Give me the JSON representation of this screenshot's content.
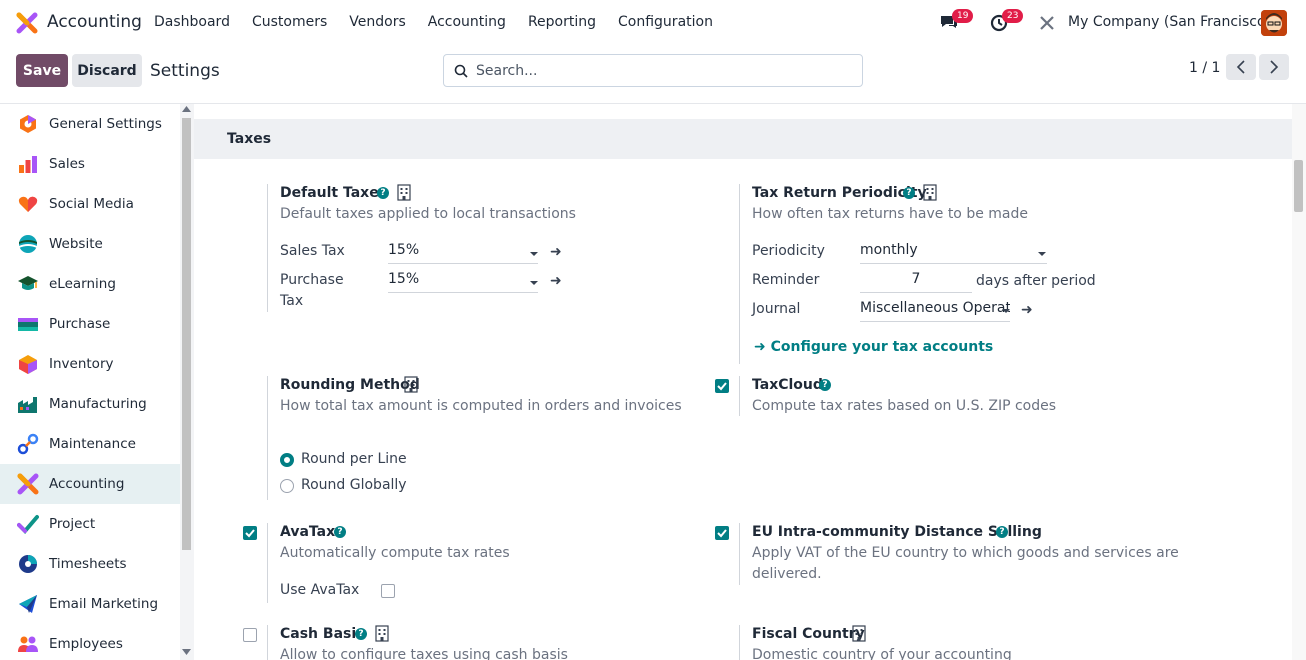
{
  "navbar": {
    "app_name": "Accounting",
    "menu": [
      "Dashboard",
      "Customers",
      "Vendors",
      "Accounting",
      "Reporting",
      "Configuration"
    ],
    "messages_count": "19",
    "activities_count": "23",
    "company": "My Company (San Francisco)"
  },
  "control_panel": {
    "save_label": "Save",
    "discard_label": "Discard",
    "title": "Settings",
    "search_placeholder": "Search...",
    "pager": "1 / 1"
  },
  "sidebar": {
    "items": [
      {
        "label": "General Settings",
        "icon": "general-settings-icon",
        "color": "#f97316"
      },
      {
        "label": "Sales",
        "icon": "sales-icon",
        "color": "#ef4444"
      },
      {
        "label": "Social Media",
        "icon": "social-media-icon",
        "color": "#f97316"
      },
      {
        "label": "Website",
        "icon": "website-icon",
        "color": "#0ea5b7"
      },
      {
        "label": "eLearning",
        "icon": "elearning-icon",
        "color": "#14532d"
      },
      {
        "label": "Purchase",
        "icon": "purchase-icon",
        "color": "#0f766e"
      },
      {
        "label": "Inventory",
        "icon": "inventory-icon",
        "color": "#f59e0b"
      },
      {
        "label": "Manufacturing",
        "icon": "manufacturing-icon",
        "color": "#0f766e"
      },
      {
        "label": "Maintenance",
        "icon": "maintenance-icon",
        "color": "#3b82f6"
      },
      {
        "label": "Accounting",
        "icon": "accounting-icon",
        "color": "#f97316",
        "active": true
      },
      {
        "label": "Project",
        "icon": "project-icon",
        "color": "#0d9488"
      },
      {
        "label": "Timesheets",
        "icon": "timesheets-icon",
        "color": "#1e3a8a"
      },
      {
        "label": "Email Marketing",
        "icon": "email-marketing-icon",
        "color": "#1d4ed8"
      },
      {
        "label": "Employees",
        "icon": "employees-icon",
        "color": "#a855f7"
      }
    ]
  },
  "section": {
    "title": "Taxes",
    "default_taxes": {
      "title": "Default Taxes",
      "desc": "Default taxes applied to local transactions",
      "sales_tax_label": "Sales Tax",
      "sales_tax_value": "15%",
      "purchase_tax_label_1": "Purchase",
      "purchase_tax_label_2": "Tax",
      "purchase_tax_value": "15%"
    },
    "tax_return": {
      "title": "Tax Return Periodicity",
      "desc": "How often tax returns have to be made",
      "periodicity_label": "Periodicity",
      "periodicity_value": "monthly",
      "reminder_label": "Reminder",
      "reminder_value": "7",
      "reminder_suffix": "days after period",
      "journal_label": "Journal",
      "journal_value": "Miscellaneous Operat",
      "configure_link": "Configure your tax accounts"
    },
    "rounding": {
      "title": "Rounding Method",
      "desc": "How total tax amount is computed in orders and invoices",
      "option_line": "Round per Line",
      "option_global": "Round Globally",
      "selected": "Round per Line"
    },
    "taxcloud": {
      "title": "TaxCloud",
      "desc": "Compute tax rates based on U.S. ZIP codes",
      "checked": true
    },
    "avatax": {
      "title": "AvaTax",
      "desc": "Automatically compute tax rates",
      "use_label": "Use AvaTax",
      "checked": true,
      "use_checked": false
    },
    "eu_distance": {
      "title": "EU Intra-community Distance Selling",
      "desc_1": "Apply VAT of the EU country to which goods and services are",
      "desc_2": "delivered.",
      "checked": true
    },
    "cash_basis": {
      "title": "Cash Basis",
      "desc": "Allow to configure taxes using cash basis",
      "checked": false
    },
    "fiscal_country": {
      "title": "Fiscal Country",
      "desc": "Domestic country of your accounting"
    }
  },
  "colors": {
    "brand": "#714b67",
    "accent": "#017e84",
    "badge": "#e11d48"
  }
}
